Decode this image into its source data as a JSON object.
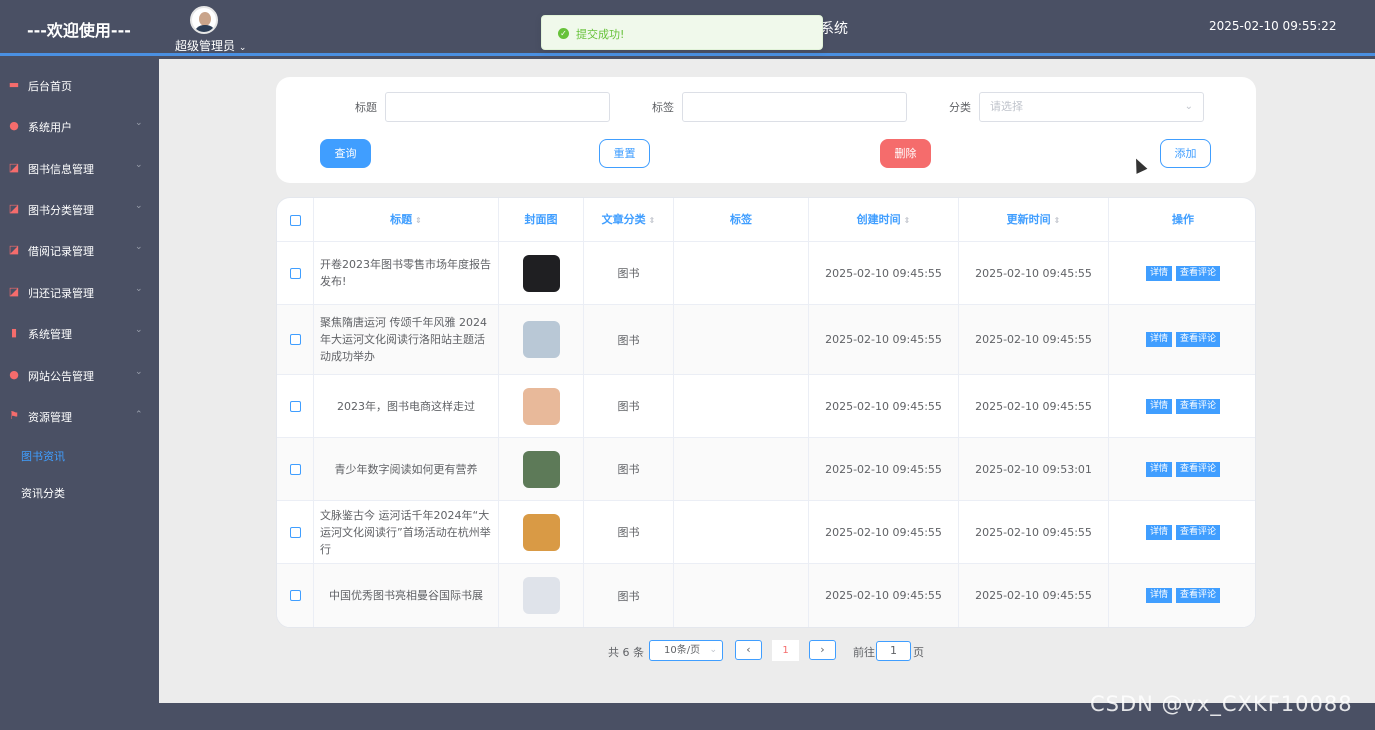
{
  "header": {
    "welcome": "---欢迎使用---",
    "admin_label": "超级管理员",
    "system_title": "系统",
    "datetime": "2025-02-10 09:55:22"
  },
  "toast": {
    "message": "提交成功!"
  },
  "sidebar": {
    "items": [
      {
        "label": "后台首页",
        "icon": "monitor-icon"
      },
      {
        "label": "系统用户",
        "icon": "user-icon"
      },
      {
        "label": "图书信息管理",
        "icon": "chart-line-icon"
      },
      {
        "label": "图书分类管理",
        "icon": "chart-line-icon"
      },
      {
        "label": "借阅记录管理",
        "icon": "chart-line-icon"
      },
      {
        "label": "归还记录管理",
        "icon": "chart-line-icon"
      },
      {
        "label": "系统管理",
        "icon": "bar-chart-icon"
      },
      {
        "label": "网站公告管理",
        "icon": "warning-icon"
      },
      {
        "label": "资源管理",
        "icon": "flag-icon"
      }
    ],
    "sub_items": [
      {
        "label": "图书资讯",
        "active": true
      },
      {
        "label": "资讯分类",
        "active": false
      }
    ]
  },
  "search": {
    "title_label": "标题",
    "tag_label": "标签",
    "category_label": "分类",
    "category_placeholder": "请选择",
    "query_button": "查询",
    "reset_button": "重置",
    "delete_button": "删除",
    "add_button": "添加"
  },
  "table": {
    "headers": {
      "title": "标题",
      "cover": "封面图",
      "category": "文章分类",
      "tag": "标签",
      "created": "创建时间",
      "updated": "更新时间",
      "actions": "操作"
    },
    "detail_label": "详情",
    "comments_label": "查看评论",
    "rows": [
      {
        "title": "开卷2023年图书零售市场年度报告发布!",
        "category": "图书",
        "tag": "",
        "created": "2025-02-10 09:45:55",
        "updated": "2025-02-10 09:45:55",
        "thumb_color": "#1f1f22"
      },
      {
        "title": "聚焦隋唐运河 传颂千年风雅 2024年大运河文化阅读行洛阳站主题活动成功举办",
        "category": "图书",
        "tag": "",
        "created": "2025-02-10 09:45:55",
        "updated": "2025-02-10 09:45:55",
        "thumb_color": "#b9c8d6"
      },
      {
        "title": "2023年，图书电商这样走过",
        "category": "图书",
        "tag": "",
        "created": "2025-02-10 09:45:55",
        "updated": "2025-02-10 09:45:55",
        "thumb_color": "#e8b99a"
      },
      {
        "title": "青少年数字阅读如何更有营养",
        "category": "图书",
        "tag": "",
        "created": "2025-02-10 09:45:55",
        "updated": "2025-02-10 09:53:01",
        "thumb_color": "#5d7a58"
      },
      {
        "title": "文脉鉴古今 运河话千年2024年“大运河文化阅读行”首场活动在杭州举行",
        "category": "图书",
        "tag": "",
        "created": "2025-02-10 09:45:55",
        "updated": "2025-02-10 09:45:55",
        "thumb_color": "#d99a45"
      },
      {
        "title": "中国优秀图书亮相曼谷国际书展",
        "category": "图书",
        "tag": "",
        "created": "2025-02-10 09:45:55",
        "updated": "2025-02-10 09:45:55",
        "thumb_color": "#dfe3ea"
      }
    ]
  },
  "pagination": {
    "total": "共 6 条",
    "page_size": "10条/页",
    "current_page": "1",
    "goto_label": "前往",
    "goto_value": "1",
    "page_suffix": "页"
  },
  "watermark": "CSDN @vx_CXKF10088"
}
